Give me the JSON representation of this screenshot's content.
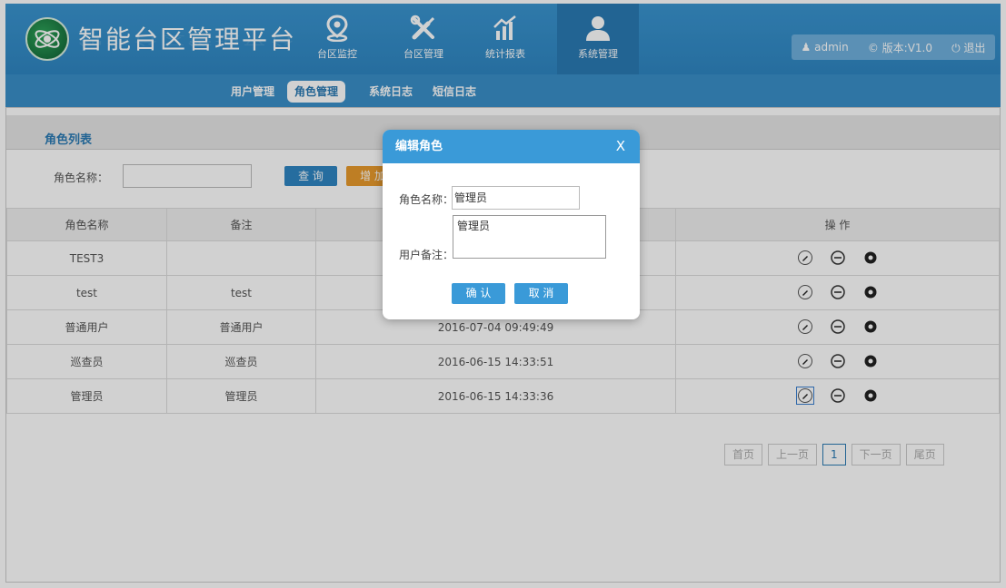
{
  "header": {
    "brand": "智能台区管理平台",
    "nav": [
      {
        "label": "台区监控",
        "icon": "location-pin-icon"
      },
      {
        "label": "台区管理",
        "icon": "tools-icon"
      },
      {
        "label": "统计报表",
        "icon": "chart-icon"
      },
      {
        "label": "系统管理",
        "icon": "user-icon"
      }
    ],
    "user": "admin",
    "version": "版本:V1.0",
    "logout": "退出"
  },
  "subnav": [
    "用户管理",
    "角色管理",
    "系统日志",
    "短信日志"
  ],
  "panel": {
    "title": "角色列表",
    "search_label": "角色名称：",
    "search_value": "",
    "query_button": "查 询",
    "add_button": "增 加"
  },
  "table": {
    "headers": [
      "角色名称",
      "备注",
      "",
      "操 作"
    ],
    "rows": [
      {
        "name": "TEST3",
        "remark": "",
        "time": ""
      },
      {
        "name": "test",
        "remark": "test",
        "time": ""
      },
      {
        "name": "普通用户",
        "remark": "普通用户",
        "time": "2016-07-04 09:49:49"
      },
      {
        "name": "巡查员",
        "remark": "巡查员",
        "time": "2016-06-15 14:33:51"
      },
      {
        "name": "管理员",
        "remark": "管理员",
        "time": "2016-06-15 14:33:36"
      }
    ]
  },
  "pager": {
    "first": "首页",
    "prev": "上一页",
    "current": "1",
    "next": "下一页",
    "last": "尾页"
  },
  "modal": {
    "title": "编辑角色",
    "close": "X",
    "name_label": "角色名称：",
    "name_value": "管理员",
    "remark_label": "用户备注：",
    "remark_value": "管理员",
    "confirm": "确 认",
    "cancel": "取 消"
  },
  "colors": {
    "primary": "#3a95d0",
    "accent": "#e89a2c",
    "active_nav": "#2a7ab4"
  }
}
